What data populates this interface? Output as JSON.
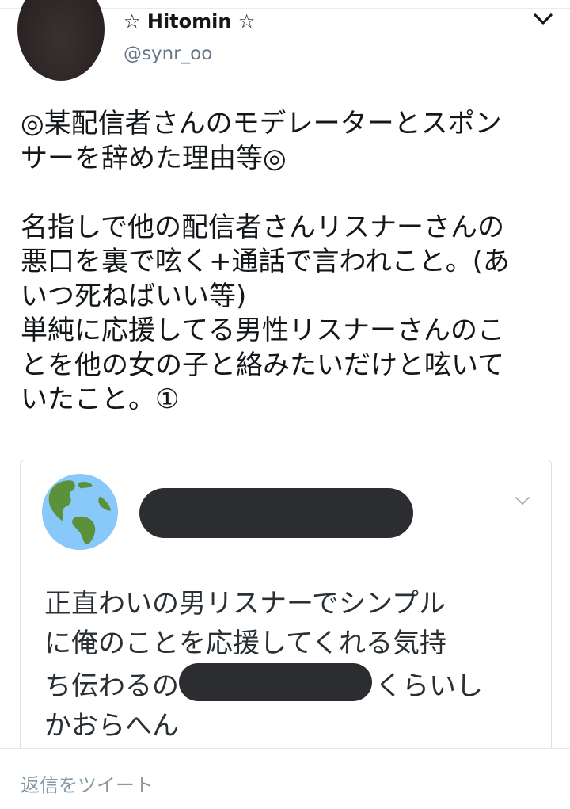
{
  "user": {
    "display_name": "☆ Hitomin ☆",
    "handle": "@synr_oo"
  },
  "tweet": {
    "lines": [
      "◎某配信者さんのモデレーターとスポン",
      "サーを辞めた理由等◎",
      "",
      "名指しで他の配信者さんリスナーさんの",
      "悪口を裏で呟く+通話で言われこと。(あ",
      "いつ死ねばいい等)",
      "単純に応援してる男性リスナーさんのこ",
      "とを他の女の子と絡みたいだけと呟いて",
      "いたこと。①"
    ]
  },
  "quoted_tweet": {
    "line1": "正直わいの男リスナーでシンプル",
    "line2": "に俺のことを応援してくれる気持",
    "line3_before": "ち伝わるの",
    "line3_after": "くらいし",
    "line4": "かおらへん"
  },
  "bottom_bar": {
    "reply_placeholder": "返信をツイート"
  },
  "icons": {
    "menu": "chevron-down-icon",
    "avatar_default": "globe-icon"
  },
  "colors": {
    "text": "#14171a",
    "secondary": "#657786",
    "placeholder": "#8899a6",
    "border": "#d9e1e7",
    "redaction": "#2b2d30"
  }
}
